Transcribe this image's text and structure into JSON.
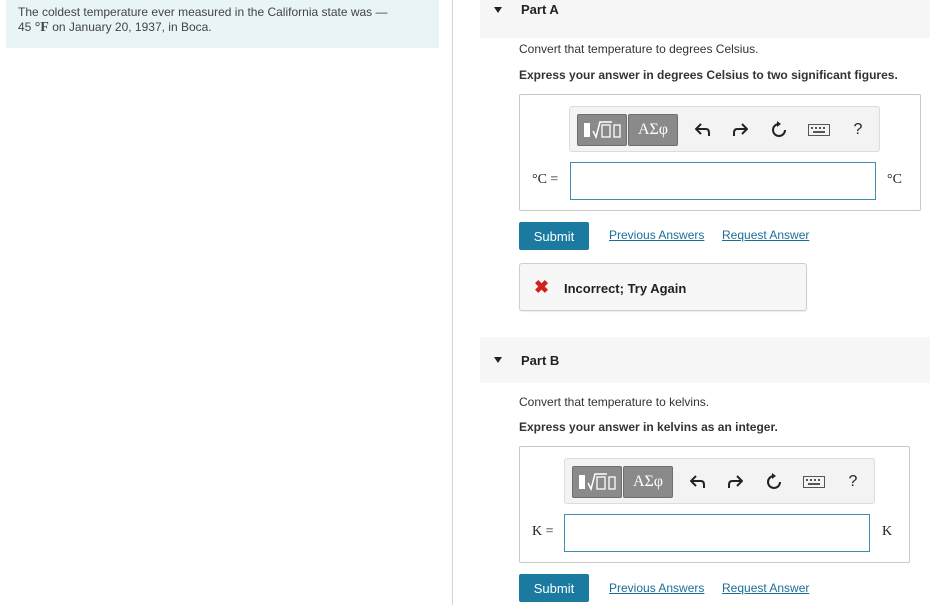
{
  "problem": {
    "intro_line1": "The coldest temperature ever measured in the California state was —",
    "temperature_value": "45",
    "temperature_unit": "°F",
    "intro_line2_rest": " on January 20, 1937, in Boca."
  },
  "parts": [
    {
      "label": "Part A",
      "prompt": "Convert that temperature to degrees Celsius.",
      "instruction": "Express your answer in degrees Celsius to two significant figures.",
      "toolbar": {
        "templates_icon": "templates-sqrt-icon",
        "greek_label": "ΑΣφ",
        "undo_icon": "undo-icon",
        "redo_icon": "redo-icon",
        "reset_icon": "reset-icon",
        "keyboard_icon": "keyboard-icon",
        "help_label": "?"
      },
      "variable_label": "°C =",
      "input_value": "",
      "unit": "°C",
      "submit_label": "Submit",
      "previous_answers_label": "Previous Answers",
      "request_answer_label": "Request Answer",
      "feedback": {
        "status": "incorrect",
        "icon": "x-mark-icon",
        "message": "Incorrect; Try Again",
        "color": "#d0221a"
      }
    },
    {
      "label": "Part B",
      "prompt": "Convert that temperature to kelvins.",
      "instruction": "Express your answer in kelvins as an integer.",
      "toolbar": {
        "templates_icon": "templates-sqrt-icon",
        "greek_label": "ΑΣφ",
        "undo_icon": "undo-icon",
        "redo_icon": "redo-icon",
        "reset_icon": "reset-icon",
        "keyboard_icon": "keyboard-icon",
        "help_label": "?"
      },
      "variable_label": "K =",
      "input_value": "",
      "unit": "K",
      "submit_label": "Submit",
      "previous_answers_label": "Previous Answers",
      "request_answer_label": "Request Answer"
    }
  ],
  "colors": {
    "accent": "#1b7aa0",
    "link": "#1b6f96",
    "intro_bg": "#e8f4f6",
    "error": "#d0221a"
  }
}
